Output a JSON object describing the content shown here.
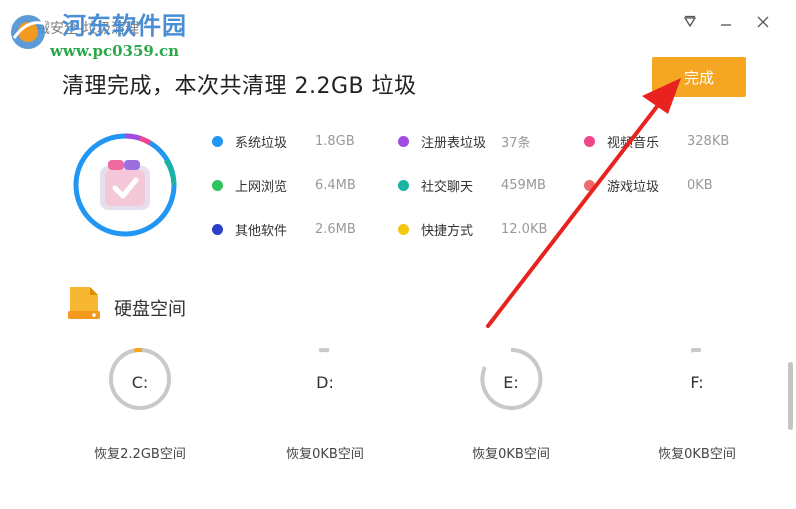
{
  "watermark": {
    "site": "河东软件园",
    "url": "www.pc0359.cn"
  },
  "window": {
    "title": "火绒安全-垃圾清理",
    "menu_icon": "dropdown-triangle-icon",
    "min_icon": "minimize-icon",
    "close_icon": "close-icon"
  },
  "header": {
    "headline": "清理完成，本次共清理 2.2GB 垃圾",
    "done_label": "完成"
  },
  "categories": [
    {
      "name": "系统垃圾",
      "size": "1.8GB",
      "color": "#2196f3"
    },
    {
      "name": "注册表垃圾",
      "size": "37条",
      "color": "#a24be0"
    },
    {
      "name": "视频音乐",
      "size": "328KB",
      "color": "#f0468c"
    },
    {
      "name": "上网浏览",
      "size": "6.4MB",
      "color": "#2fc45c"
    },
    {
      "name": "社交聊天",
      "size": "459MB",
      "color": "#19b3a3"
    },
    {
      "name": "游戏垃圾",
      "size": "0KB",
      "color": "#f06b6b"
    },
    {
      "name": "其他软件",
      "size": "2.6MB",
      "color": "#2d3fc4"
    },
    {
      "name": "快捷方式",
      "size": "12.0KB",
      "color": "#f2c811"
    }
  ],
  "disk_section": {
    "title": "硬盘空间"
  },
  "drives": [
    {
      "letter": "C:",
      "recovered": "恢复2.2GB空间"
    },
    {
      "letter": "D:",
      "recovered": "恢复0KB空间"
    },
    {
      "letter": "E:",
      "recovered": "恢复0KB空间"
    },
    {
      "letter": "F:",
      "recovered": "恢复0KB空间"
    }
  ],
  "colors": {
    "accent": "#f5a623",
    "ring": "#2196f3",
    "arrow": "#e8231f"
  }
}
